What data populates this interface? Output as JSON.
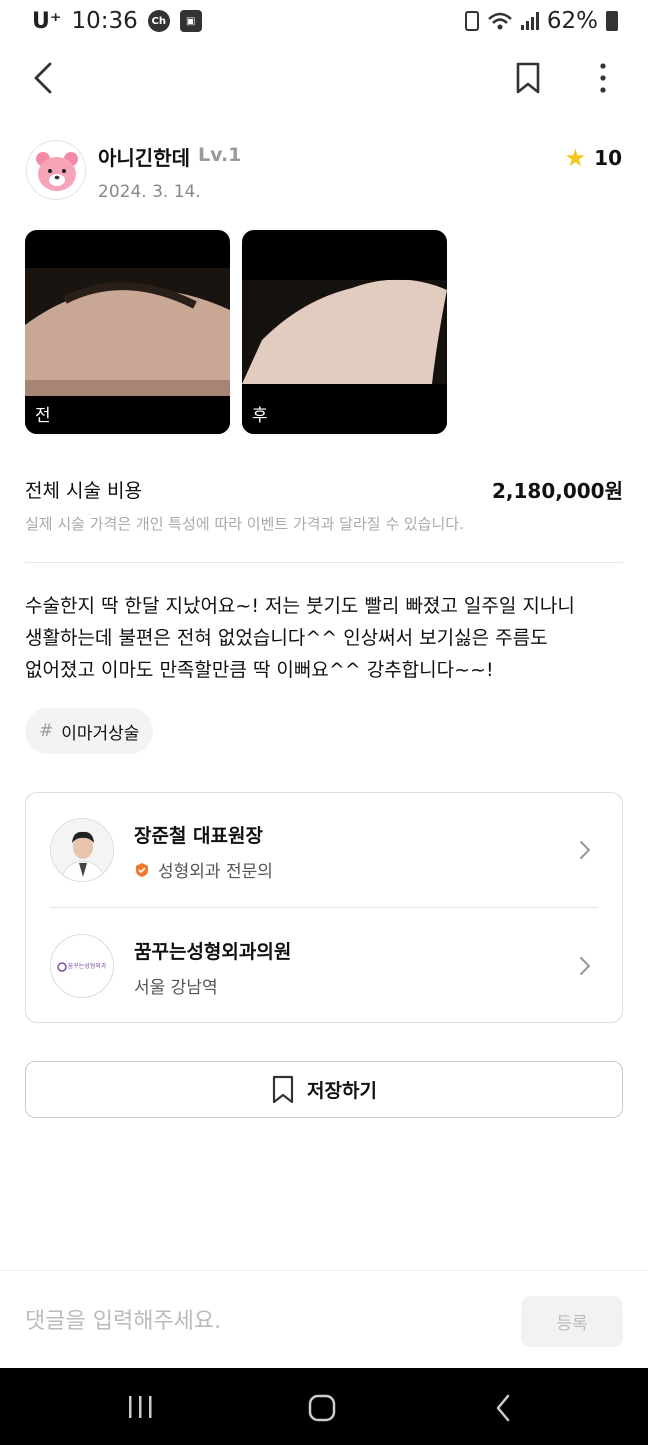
{
  "status_bar": {
    "carrier": "U⁺",
    "time": "10:36",
    "battery": "62%"
  },
  "nav": {
    "back_icon": "chevron-left-icon",
    "bookmark_icon": "bookmark-icon",
    "more_icon": "more-vertical-icon"
  },
  "author": {
    "name": "아니긴한데",
    "level": "Lv.1",
    "date": "2024. 3. 14.",
    "rating": "10"
  },
  "photos": [
    {
      "label": "전"
    },
    {
      "label": "후"
    }
  ],
  "price": {
    "label": "전체 시술 비용",
    "value": "2,180,000원",
    "note": "실제 시술 가격은 개인 특성에 따라 이벤트 가격과 달라질 수 있습니다."
  },
  "review": {
    "line1": "수술한지 딱 한달 지났어요~! 저는 붓기도 빨리 빠졌고 일주일 지나니",
    "line2": "생활하는데 불편은 전혀 없었습니다^^ 인상써서 보기싫은 주름도",
    "line3": "없어졌고 이마도 만족할만큼 딱 이뻐요^^ 강추합니다~~!"
  },
  "tag": {
    "hash": "#",
    "label": "이마거상술"
  },
  "doctor": {
    "name": "장준철 대표원장",
    "specialty": "성형외과 전문의"
  },
  "clinic": {
    "name": "꿈꾸는성형외과의원",
    "location": "서울 강남역",
    "logo_text": "꿈꾸는성형외과"
  },
  "save_button": {
    "label": "저장하기"
  },
  "comment": {
    "placeholder": "댓글을 입력해주세요.",
    "submit_label": "등록"
  },
  "colors": {
    "star": "#f5c518",
    "badge": "#f07a2a",
    "clinic_logo": "#7a4ea0"
  }
}
